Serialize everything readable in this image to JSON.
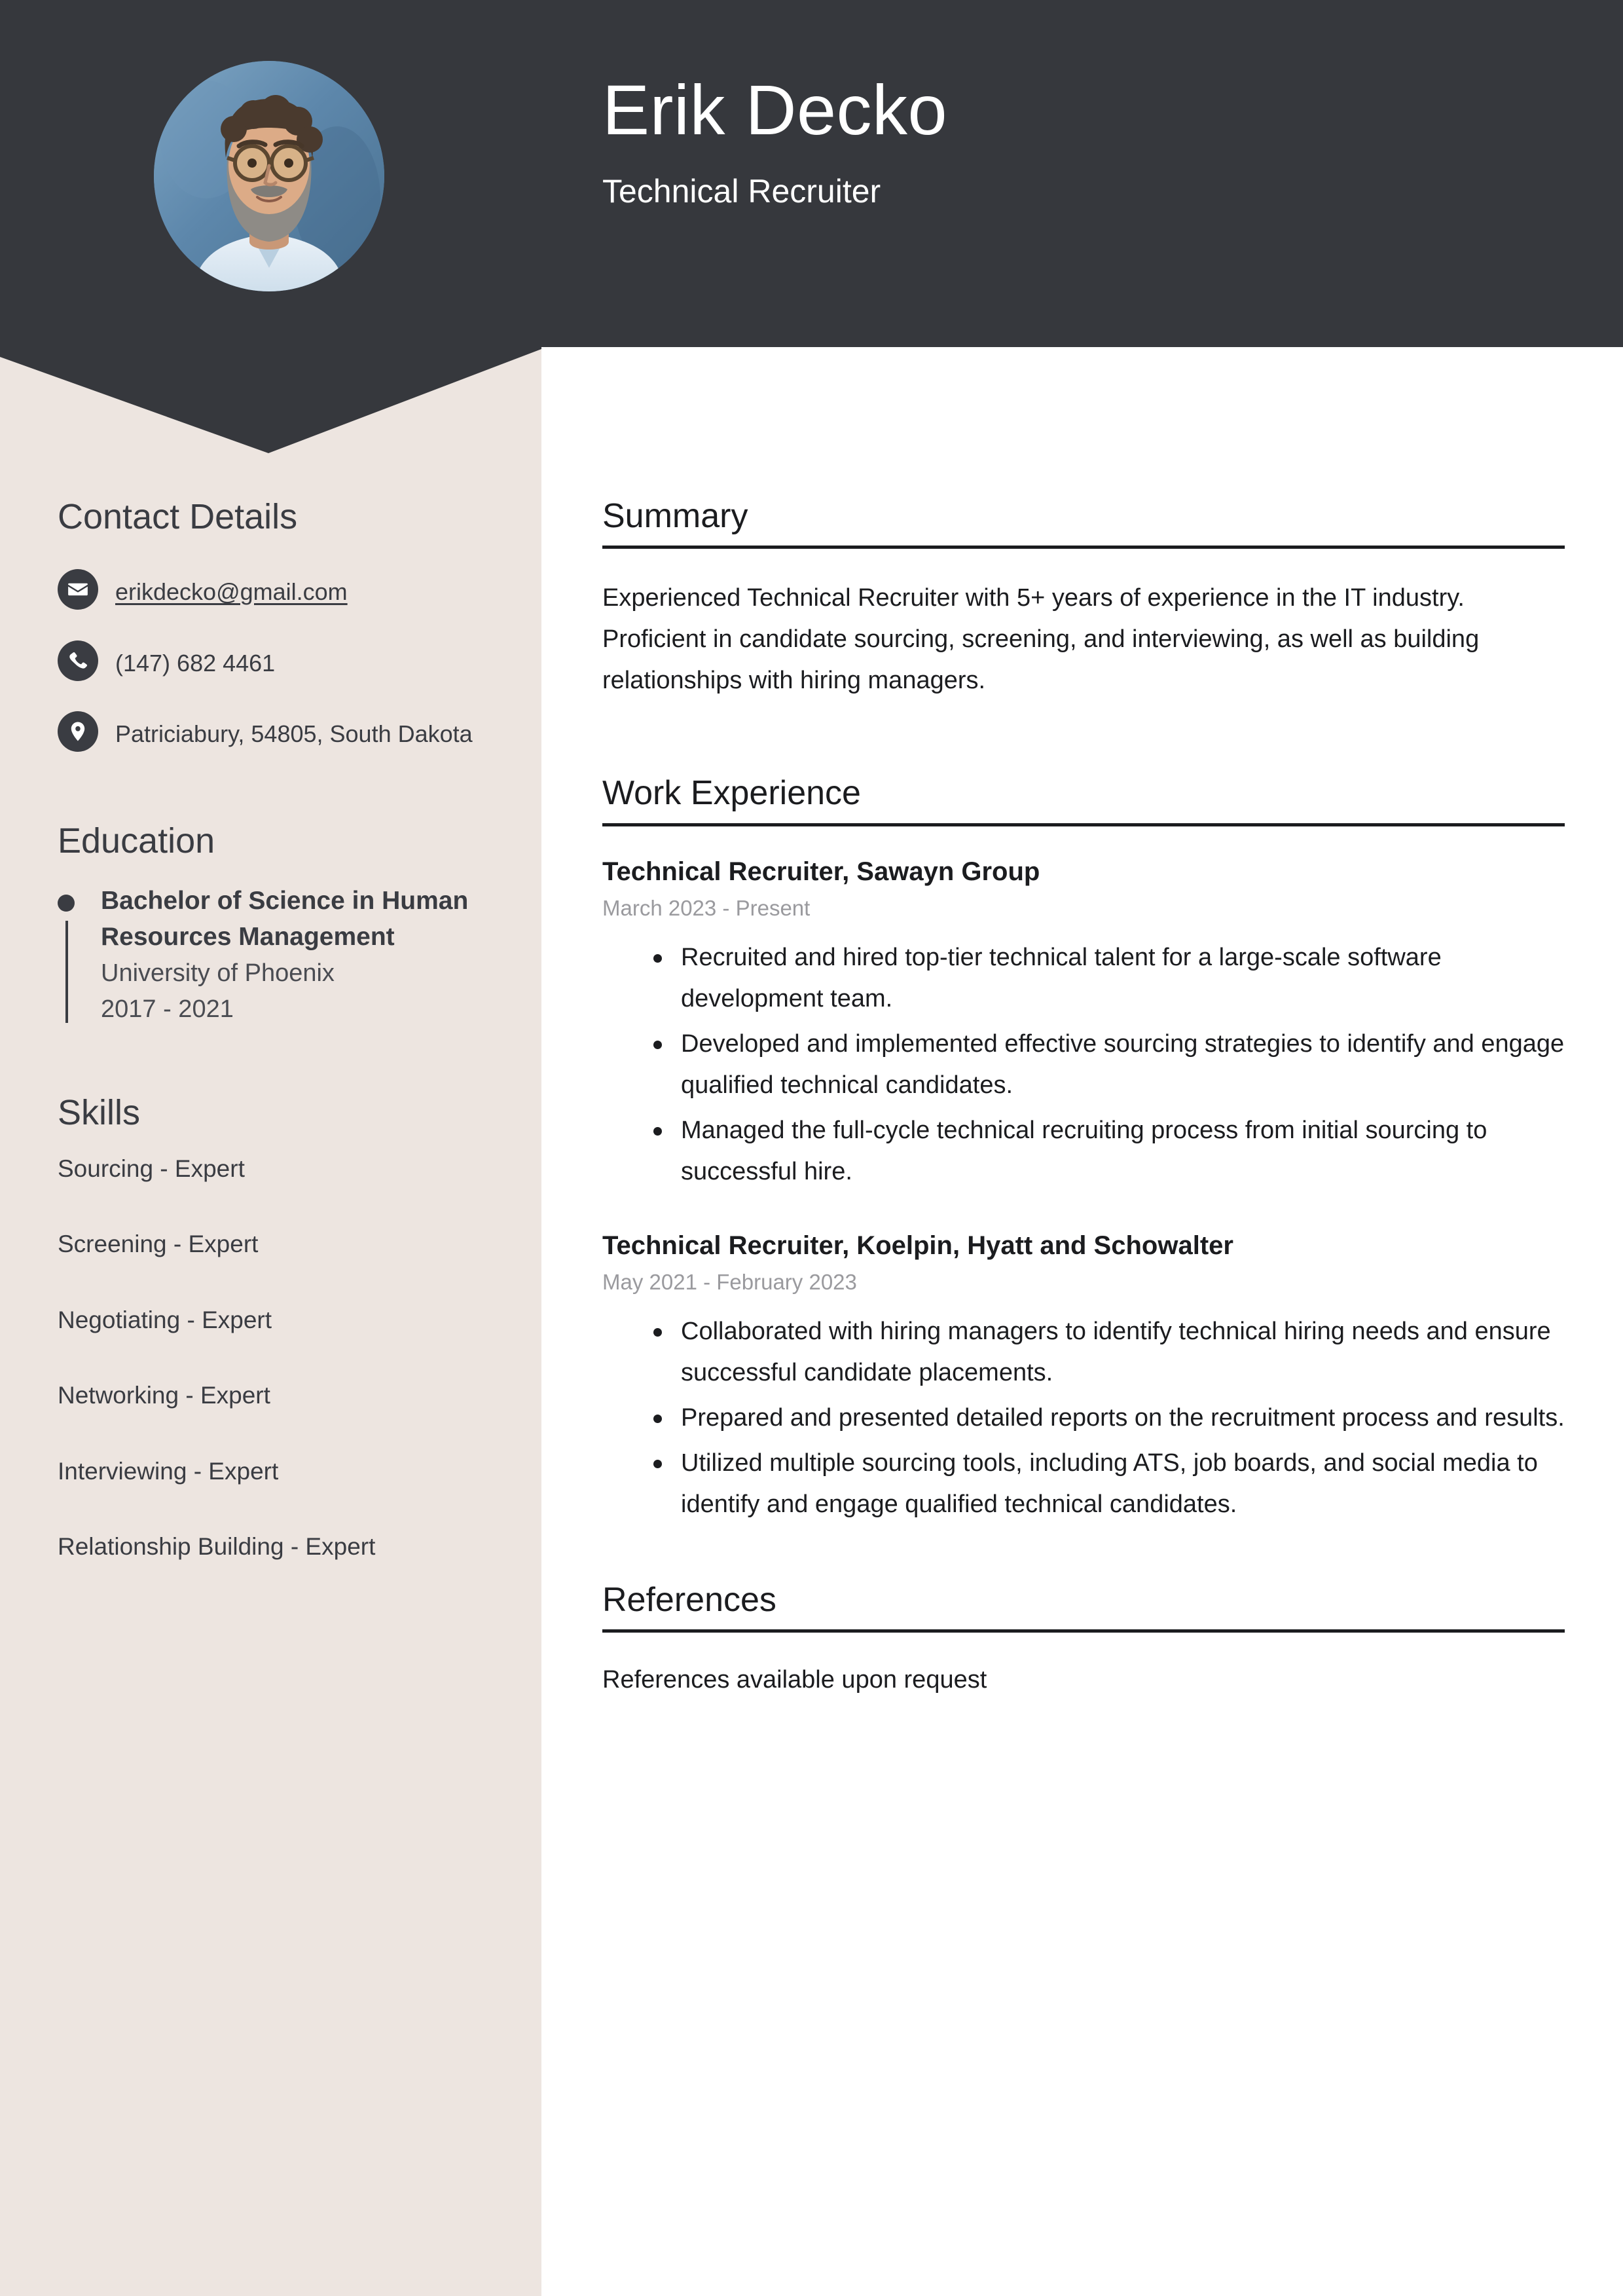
{
  "colors": {
    "header_bg": "#36383D",
    "sidebar_bg": "#EDE5E0",
    "page_bg": "#FFFFFF",
    "text_dark": "#1B1C1F",
    "muted_date": "#9A9A9E"
  },
  "header": {
    "name": "Erik Decko",
    "job_title": "Technical Recruiter",
    "avatar_alt": "profile-photo"
  },
  "sidebar": {
    "contact": {
      "heading": "Contact Details",
      "items": [
        {
          "icon": "envelope-icon",
          "value": "erikdecko@gmail.com",
          "is_link": true
        },
        {
          "icon": "phone-icon",
          "value": "(147) 682 4461",
          "is_link": false
        },
        {
          "icon": "location-pin-icon",
          "value": "Patriciabury, 54805, South Dakota",
          "is_link": false
        }
      ]
    },
    "education": {
      "heading": "Education",
      "items": [
        {
          "degree": "Bachelor of Science in Human Resources Management",
          "school": "University of Phoenix",
          "dates": "2017 - 2021"
        }
      ]
    },
    "skills": {
      "heading": "Skills",
      "items": [
        "Sourcing - Expert",
        "Screening - Expert",
        "Negotiating - Expert",
        "Networking - Expert",
        "Interviewing - Expert",
        "Relationship Building - Expert"
      ]
    }
  },
  "main": {
    "summary": {
      "heading": "Summary",
      "text": "Experienced Technical Recruiter with 5+ years of experience in the IT industry. Proficient in candidate sourcing, screening, and interviewing, as well as building relationships with hiring managers."
    },
    "work_experience": {
      "heading": "Work Experience",
      "jobs": [
        {
          "title": "Technical Recruiter, Sawayn Group",
          "dates": "March 2023 - Present",
          "bullets": [
            "Recruited and hired top-tier technical talent for a large-scale software development team.",
            "Developed and implemented effective sourcing strategies to identify and engage qualified technical candidates.",
            "Managed the full-cycle technical recruiting process from initial sourcing to successful hire."
          ]
        },
        {
          "title": "Technical Recruiter, Koelpin, Hyatt and Schowalter",
          "dates": "May 2021 - February 2023",
          "bullets": [
            "Collaborated with hiring managers to identify technical hiring needs and ensure successful candidate placements.",
            "Prepared and presented detailed reports on the recruitment process and results.",
            "Utilized multiple sourcing tools, including ATS, job boards, and social media to identify and engage qualified technical candidates."
          ]
        }
      ]
    },
    "references": {
      "heading": "References",
      "text": "References available upon request"
    }
  }
}
